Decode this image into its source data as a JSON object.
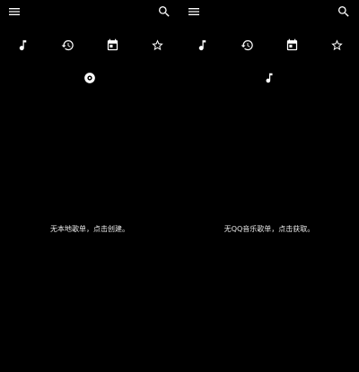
{
  "panels": [
    {
      "icons": {
        "menu": "menu-icon",
        "search": "search-icon",
        "tabs": [
          "music-note-icon",
          "history-icon",
          "calendar-icon",
          "star-icon"
        ],
        "sub": "disc-icon"
      },
      "empty_text": "无本地歌单，点击创建。"
    },
    {
      "icons": {
        "menu": "menu-icon",
        "search": "search-icon",
        "tabs": [
          "music-note-icon",
          "history-icon",
          "calendar-icon",
          "star-icon"
        ],
        "sub": "music-note-small-icon"
      },
      "empty_text": "无QQ音乐歌单，点击获取。"
    }
  ],
  "colors": {
    "background": "#000000",
    "foreground": "#ffffff"
  }
}
